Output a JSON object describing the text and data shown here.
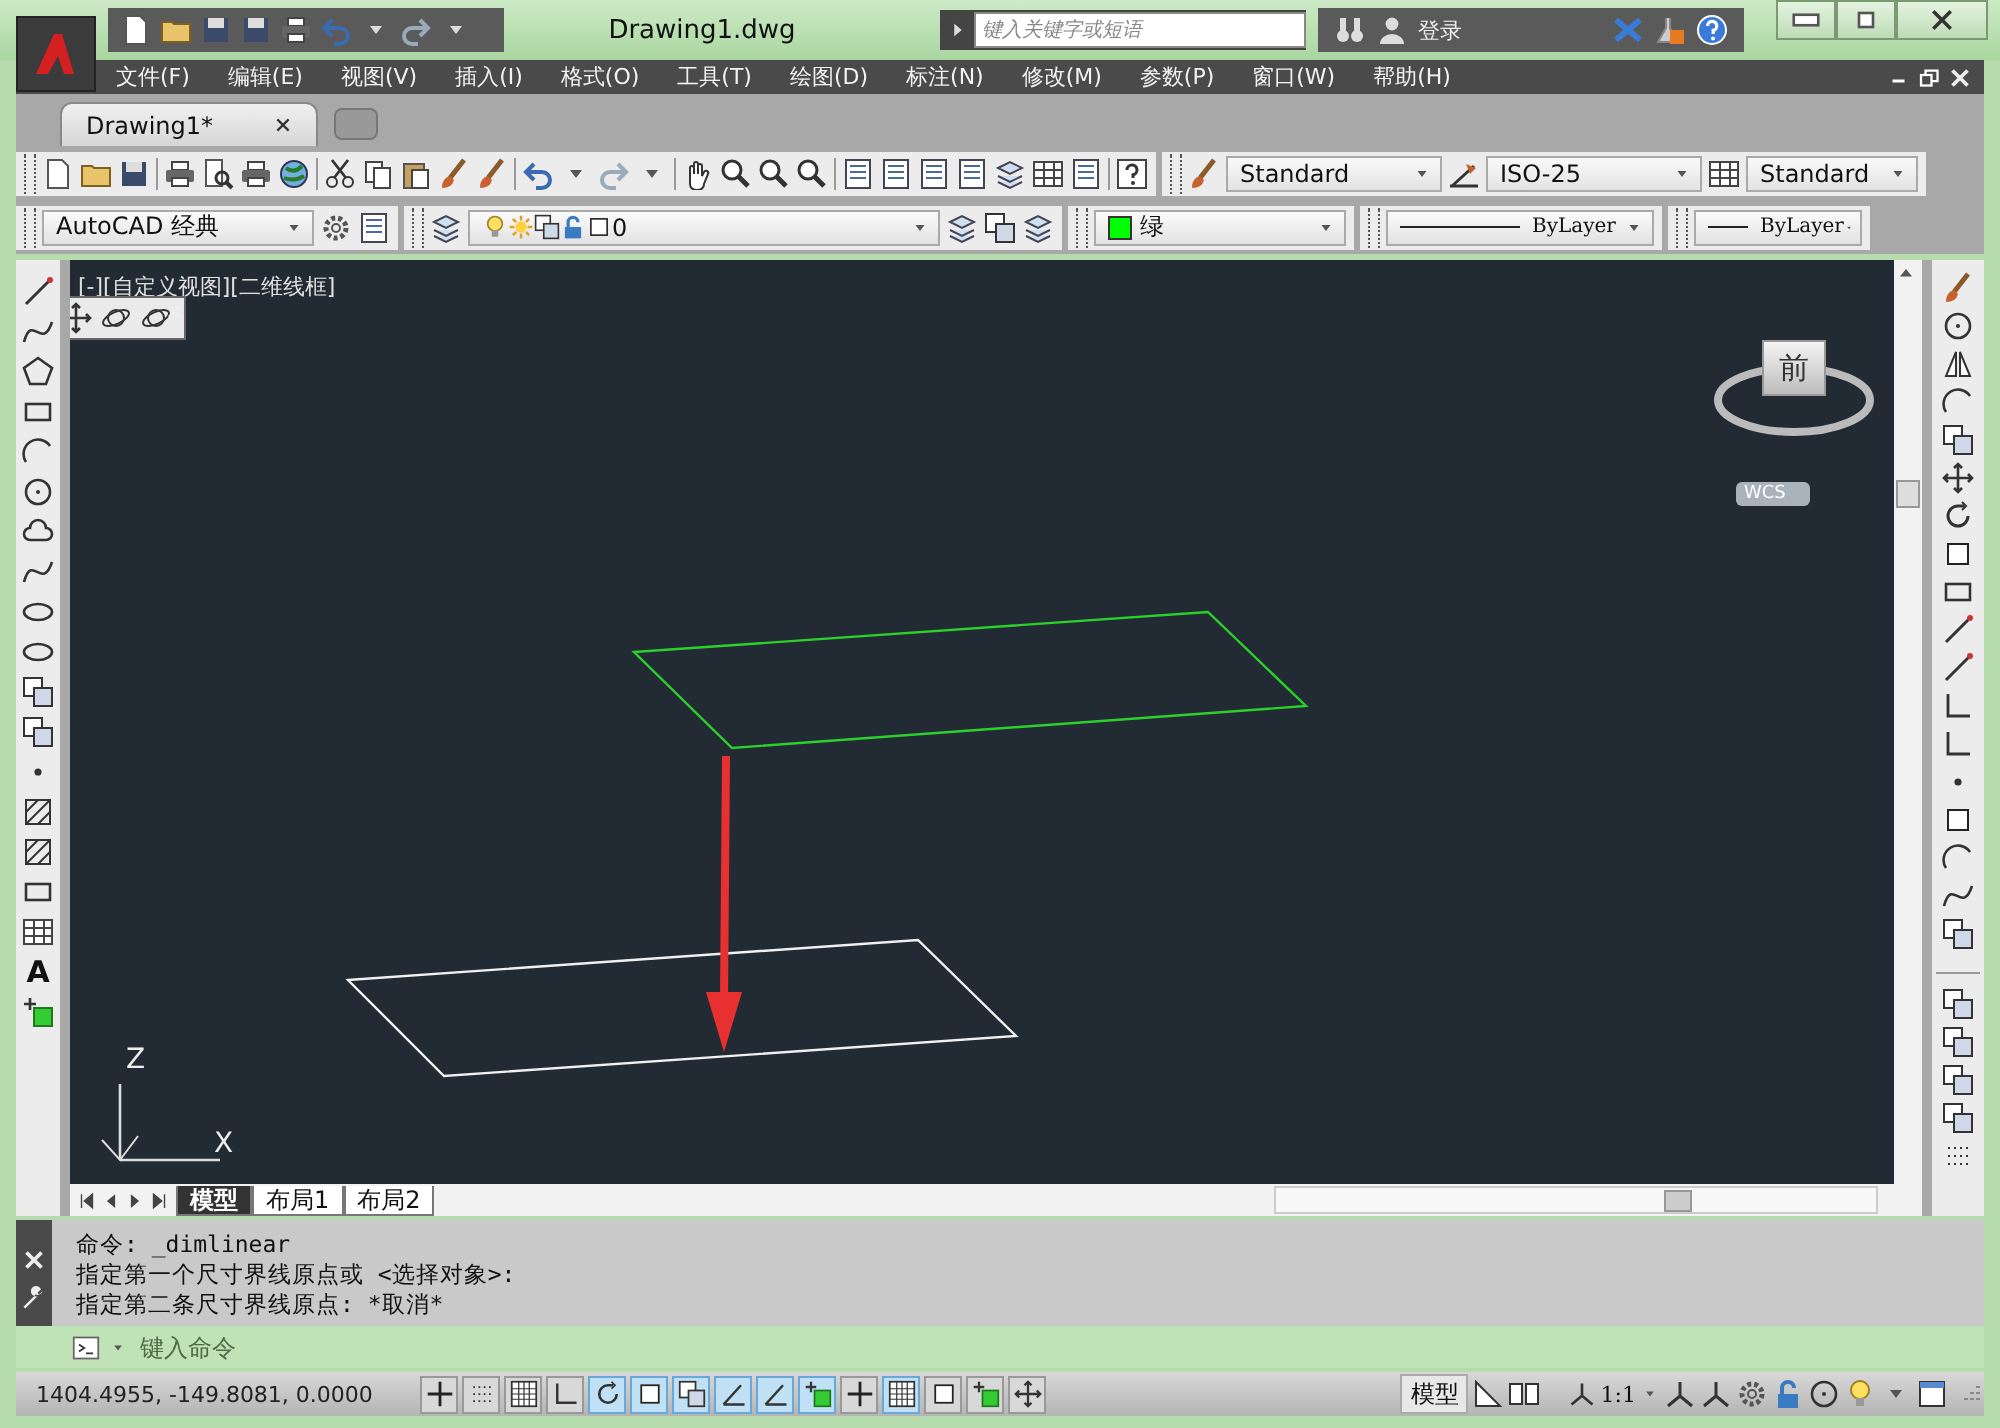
{
  "title_bar": {
    "title": "Drawing1.dwg",
    "search": {
      "placeholder": "键入关键字或短语"
    },
    "sign_in": "登录"
  },
  "menu_bar": [
    "文件(F)",
    "编辑(E)",
    "视图(V)",
    "插入(I)",
    "格式(O)",
    "工具(T)",
    "绘图(D)",
    "标注(N)",
    "修改(M)",
    "参数(P)",
    "窗口(W)",
    "帮助(H)"
  ],
  "document_tabs": [
    {
      "label": "Drawing1*",
      "selected": true
    }
  ],
  "styles_toolbar": {
    "text_style": "Standard",
    "dimension_style": "ISO-25",
    "table_style": "Standard"
  },
  "layers_toolbar": {
    "workspace": "AutoCAD 经典",
    "layer": "0",
    "color_name": "绿",
    "linetype": "ByLayer",
    "lineweight": "ByLayer"
  },
  "draw_toolbar": {
    "text_tool": "A"
  },
  "viewport": {
    "label": "[-][自定义视图][二维线框]",
    "viewcube_face": "前",
    "coordinate_system": "WCS",
    "axis_z": "Z",
    "axis_x": "X"
  },
  "layout_tabs": [
    {
      "label": "模型",
      "selected": true
    },
    {
      "label": "布局1",
      "selected": false
    },
    {
      "label": "布局2",
      "selected": false
    }
  ],
  "command_history": [
    "命令: _dimlinear",
    "指定第一个尺寸界线原点或 <选择对象>:",
    "指定第二条尺寸界线原点: *取消*"
  ],
  "command_input": {
    "placeholder": "键入命令"
  },
  "status_bar": {
    "coordinates": "1404.4955, -149.8081, 0.0000",
    "toggles": [
      {
        "on": false
      },
      {
        "on": false
      },
      {
        "on": false
      },
      {
        "on": false
      },
      {
        "on": true
      },
      {
        "on": true
      },
      {
        "on": true
      },
      {
        "on": true
      },
      {
        "on": true
      },
      {
        "on": true
      },
      {
        "on": false
      },
      {
        "on": true
      },
      {
        "on": false
      },
      {
        "on": false
      },
      {
        "on": false
      }
    ],
    "space": "模型",
    "annotation_scale": "1:1"
  }
}
